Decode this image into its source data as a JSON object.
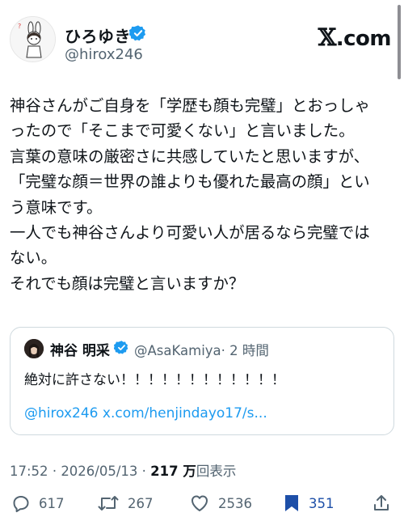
{
  "author": {
    "name": "ひろゆき",
    "handle": "@hirox246",
    "verified": true
  },
  "brand": {
    "logo_mark": "𝕏",
    "logo_text": ".com"
  },
  "post": {
    "lines": [
      "神谷さんがご自身を「学歴も顔も完璧」とおっしゃ",
      "ったので「そこまで可愛くない」と言いました。",
      "言葉の意味の厳密さに共感していたと思いますが、",
      "「完璧な顔＝世界の誰よりも優れた最高の顔」とい",
      "う意味です。",
      "一人でも神谷さんより可愛い人が居るなら完璧では",
      "ない。",
      "それでも顔は完璧と言いますか？"
    ]
  },
  "quote": {
    "name": "神谷 明采",
    "handle": "@AsaKamiya",
    "time": "· 2 時間",
    "text": "絶対に許さない！！！！！！！！！！！！",
    "mention": "@hirox246",
    "link": "x.com/henjindayo17/s..."
  },
  "meta": {
    "time": "17:52",
    "sep": "·",
    "date": "2026/05/13",
    "views_count": "217 万",
    "views_label": "回表示"
  },
  "actions": {
    "replies": "617",
    "reposts": "267",
    "likes": "2536",
    "bookmarks": "351"
  },
  "colors": {
    "accent": "#1d9bf0",
    "bookmark": "#1d4fa8",
    "secondary_text": "#536471"
  },
  "icons": [
    "verified-badge-icon",
    "reply-icon",
    "repost-icon",
    "like-icon",
    "bookmark-icon",
    "share-icon"
  ]
}
